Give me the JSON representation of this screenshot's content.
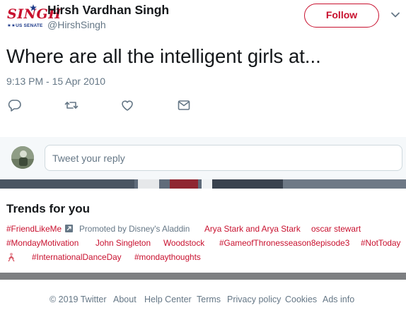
{
  "tweet": {
    "logo_text": "SINGH",
    "logo_sub": "US SENATE",
    "display_name": "Hirsh Vardhan Singh",
    "handle": "@HirshSingh",
    "follow_label": "Follow",
    "text": "Where are all the intelligent girls at...",
    "timestamp": "9:13 PM - 15 Apr 2010",
    "actions": [
      "reply-icon",
      "retweet-icon",
      "like-icon",
      "direct-message-icon"
    ]
  },
  "reply": {
    "placeholder": "Tweet your reply"
  },
  "trends": {
    "title": "Trends for you",
    "row1": {
      "t1": "#FriendLikeMe",
      "promoted": "Promoted by Disney's Aladdin",
      "t2": "Arya Stark and Arya Stark",
      "t3": "oscar stewart"
    },
    "row2": {
      "t1": "#MondayMotivation",
      "t2": "John Singleton",
      "t3": "Woodstock",
      "t4": "#GameofThronesseason8episode3",
      "t5": "#NotToday"
    },
    "row3": {
      "t1": "#InternationalDanceDay",
      "t2": "#mondaythoughts"
    }
  },
  "footer": {
    "copyright": "© 2019 Twitter",
    "about": "About",
    "help": "Help Center",
    "terms": "Terms",
    "privacy": "Privacy policy",
    "cookies": "Cookies",
    "ads": "Ads info"
  },
  "colors": {
    "accent": "#c8102e",
    "muted": "#657786",
    "text": "#14171a",
    "link_blue": "#1d3a8a"
  }
}
